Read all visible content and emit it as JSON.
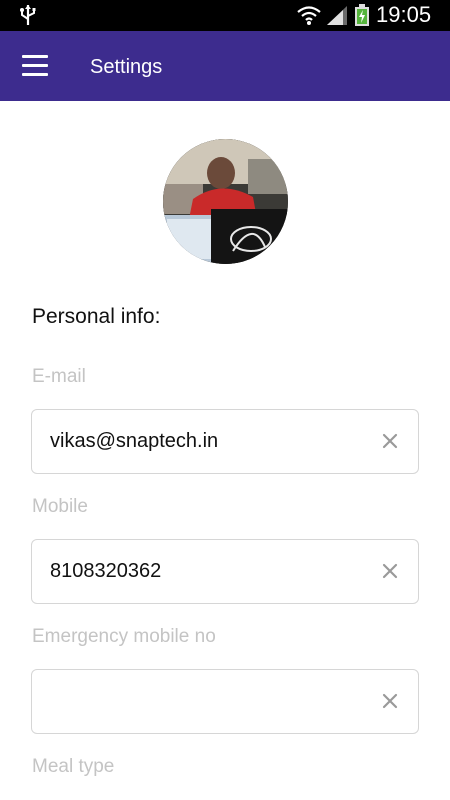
{
  "status_bar": {
    "time": "19:05"
  },
  "app_bar": {
    "title": "Settings"
  },
  "profile": {
    "section_title": "Personal info:"
  },
  "fields": {
    "email": {
      "label": "E-mail",
      "value": "vikas@snaptech.in"
    },
    "mobile": {
      "label": "Mobile",
      "value": "8108320362"
    },
    "emergency": {
      "label": "Emergency mobile no",
      "value": ""
    },
    "meal": {
      "label": "Meal type"
    }
  },
  "colors": {
    "app_bar": "#3d2c8e",
    "label": "#c4c4c4",
    "border": "#d6d6d6"
  }
}
